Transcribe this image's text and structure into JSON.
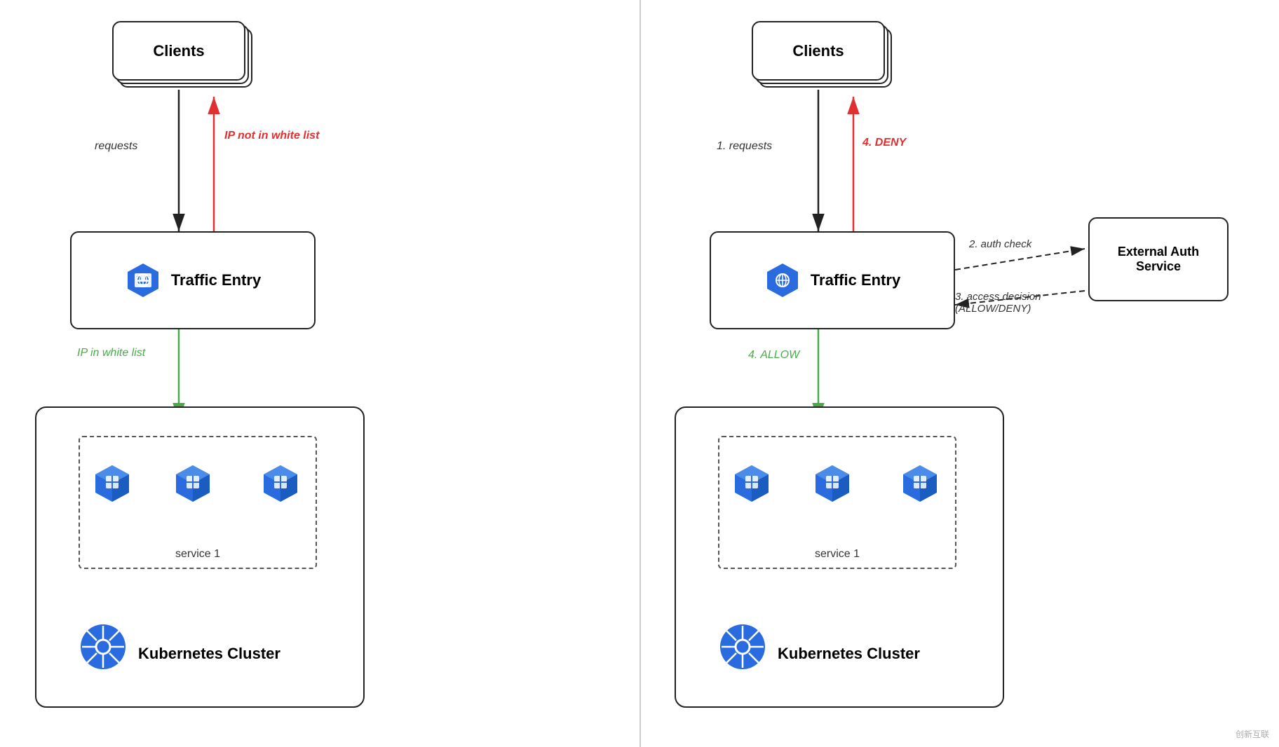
{
  "left_diagram": {
    "clients_label": "Clients",
    "traffic_entry_label": "Traffic Entry",
    "requests_label": "requests",
    "ip_not_whitelist_label": "IP not in white list",
    "ip_whitelist_label": "IP in white list",
    "service_label": "service 1",
    "k8s_label": "Kubernetes Cluster"
  },
  "right_diagram": {
    "clients_label": "Clients",
    "traffic_entry_label": "Traffic Entry",
    "requests_label": "1. requests",
    "deny_label": "4. DENY",
    "allow_label": "4. ALLOW",
    "auth_check_label": "2. auth check",
    "access_decision_label": "3. access decision\n(ALLOW/DENY)",
    "ext_auth_label": "External Auth\nService",
    "service_label": "service 1",
    "k8s_label": "Kubernetes Cluster"
  },
  "watermark": "创新互联"
}
